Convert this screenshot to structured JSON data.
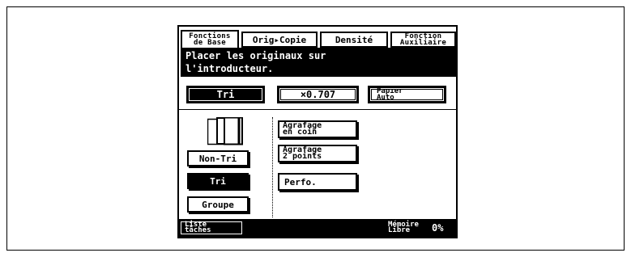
{
  "tabs": {
    "base_line1": "Fonctions",
    "base_line2": "de Base",
    "orig_copie": "Orig▸Copie",
    "densite": "Densité",
    "aux_line1": "Fonction",
    "aux_line2": "Auxiliaire"
  },
  "message": {
    "line1": "Placer les originaux sur",
    "line2": "l'introducteur."
  },
  "quick": {
    "tri": "Tri",
    "zoom": "×0.707",
    "papier_line1": "Papier",
    "papier_line2": "Auto"
  },
  "sort_options": {
    "non_tri": "Non-Tri",
    "tri": "Tri",
    "groupe": "Groupe",
    "selected": "Tri"
  },
  "finishing": {
    "agrafage_coin_line1": "Agrafage",
    "agrafage_coin_line2": "en coin",
    "agrafage_points_line1": "Agrafage",
    "agrafage_points_line2": "2 points",
    "perfo": "Perfo."
  },
  "status": {
    "liste_line1": "Liste",
    "liste_line2": "tâches",
    "memoire_line1": "Mémoire",
    "memoire_line2": "Libre",
    "memoire_value": "0%"
  },
  "icons": {
    "sort_stack": "stacked-pages-icon"
  }
}
